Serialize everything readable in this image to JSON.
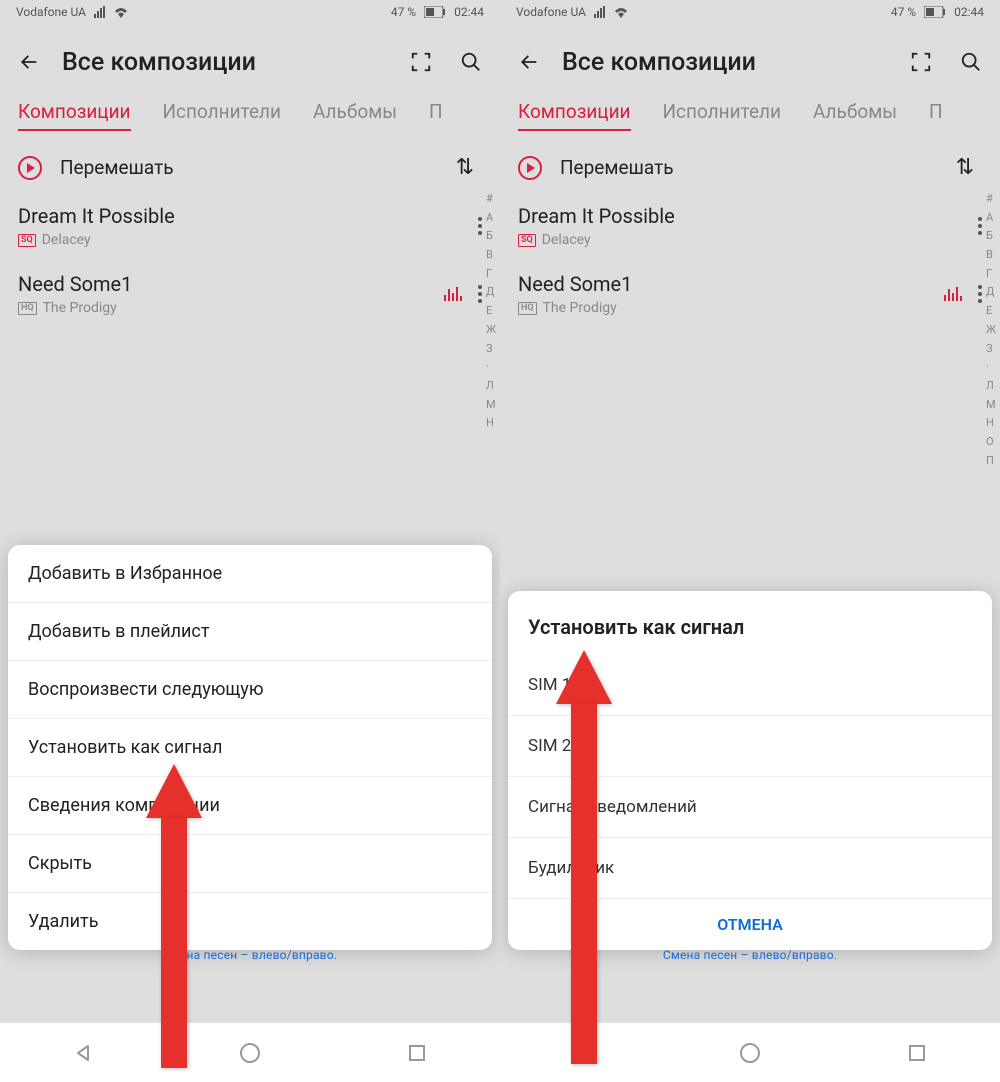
{
  "status": {
    "carrier": "Vodafone UA",
    "battery": "47 %",
    "time": "02:44"
  },
  "header": {
    "title": "Все композиции"
  },
  "tabs": [
    "Композиции",
    "Исполнители",
    "Альбомы",
    "П"
  ],
  "shuffle": "Перемешать",
  "songs": [
    {
      "title": "Dream It Possible",
      "artist": "Delacey",
      "badge": "SQ"
    },
    {
      "title": "Need Some1",
      "artist": "The Prodigy",
      "badge": "HQ"
    }
  ],
  "alpha_index_left": "#\nА\nБ\nВ\nГ\nД\nЕ\nЖ\nЗ\n·\nЛ\nМ\nН",
  "alpha_index_right": "#\nА\nБ\nВ\nГ\nД\nЕ\nЖ\nЗ\n·\nЛ\nМ\nН\nО\nП",
  "menu": {
    "items": [
      "Добавить в Избранное",
      "Добавить в плейлист",
      "Воспроизвести следующую",
      "Установить как сигнал",
      "Сведения композиции",
      "Скрыть",
      "Удалить"
    ]
  },
  "dialog": {
    "title": "Установить как сигнал",
    "items": [
      "SIM 1",
      "SIM 2",
      "Сигнал уведомлений",
      "Будильник"
    ],
    "cancel": "ОТМЕНА"
  },
  "hint": "Смена песен – влево/вправо."
}
